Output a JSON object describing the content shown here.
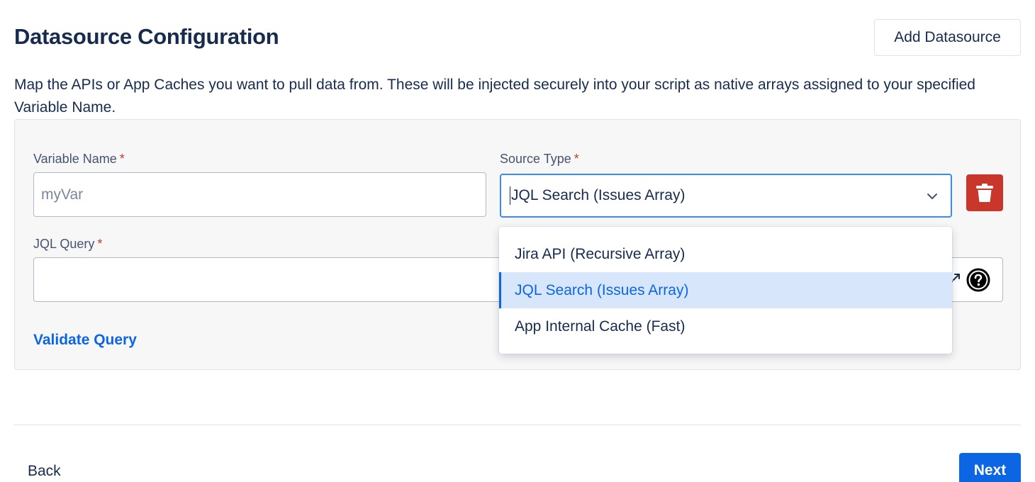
{
  "header": {
    "title": "Datasource Configuration",
    "add_button_label": "Add Datasource"
  },
  "description": "Map the APIs or App Caches you want to pull data from. These will be injected securely into your script as native arrays assigned to your specified Variable Name.",
  "form": {
    "variable_name": {
      "label": "Variable Name",
      "required_marker": "*",
      "placeholder": "myVar",
      "value": ""
    },
    "source_type": {
      "label": "Source Type",
      "required_marker": "*",
      "selected": "JQL Search (Issues Array)",
      "options": [
        "Jira API (Recursive Array)",
        "JQL Search (Issues Array)",
        "App Internal Cache (Fast)"
      ]
    },
    "jql_query": {
      "label": "JQL Query",
      "required_marker": "*",
      "value": ""
    },
    "validate_label": "Validate Query"
  },
  "footer": {
    "back_label": "Back",
    "next_label": "Next"
  },
  "colors": {
    "primary": "#0c66e4",
    "danger": "#c9372c",
    "focus_border": "#388bff",
    "selected_option_bg": "#d8e6fb"
  },
  "icons": {
    "delete": "trash-icon",
    "source_caret": "chevron-down-icon",
    "expand": "expand-icon",
    "help": "question-circle-icon"
  }
}
